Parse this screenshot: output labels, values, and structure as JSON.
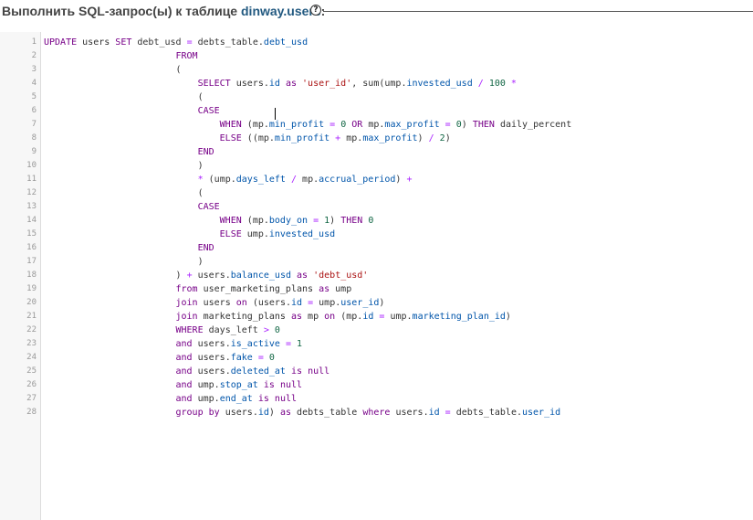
{
  "header": {
    "title_prefix": "Выполнить SQL-запрос(ы) к таблице ",
    "table_name": "dinway.users",
    "title_suffix": ":",
    "help_icon": "question-circle-icon"
  },
  "editor": {
    "line_numbers": [
      "1",
      "2",
      "3",
      "4",
      "5",
      "6",
      "7",
      "8",
      "9",
      "10",
      "11",
      "12",
      "13",
      "14",
      "15",
      "16",
      "17",
      "18",
      "19",
      "20",
      "21",
      "22",
      "23",
      "24",
      "25",
      "26",
      "27",
      "28"
    ],
    "lines": [
      "UPDATE users SET debt_usd = debts_table.debt_usd",
      "                        FROM",
      "                        (",
      "                            SELECT users.id as 'user_id', sum(ump.invested_usd / 100 *",
      "                            (",
      "                            CASE",
      "                                WHEN (mp.min_profit = 0 OR mp.max_profit = 0) THEN daily_percent",
      "                                ELSE ((mp.min_profit + mp.max_profit) / 2)",
      "                            END",
      "                            )",
      "                            * (ump.days_left / mp.accrual_period) +",
      "                            (",
      "                            CASE",
      "                                WHEN (mp.body_on = 1) THEN 0",
      "                                ELSE ump.invested_usd",
      "                            END",
      "                            )",
      "                        ) + users.balance_usd as 'debt_usd'",
      "                        from user_marketing_plans as ump",
      "                        join users on (users.id = ump.user_id)",
      "                        join marketing_plans as mp on (mp.id = ump.marketing_plan_id)",
      "                        WHERE days_left > 0",
      "                        and users.is_active = 1",
      "                        and users.fake = 0",
      "                        and users.deleted_at is null",
      "                        and ump.stop_at is null",
      "                        and ump.end_at is null",
      "                        group by users.id) as debts_table where users.id = debts_table.user_id"
    ]
  },
  "colors": {
    "keyword": "#770088",
    "field": "#0055aa",
    "string": "#aa1111",
    "number": "#116644",
    "operator": "#aa22ff",
    "title_table": "#235a81"
  }
}
